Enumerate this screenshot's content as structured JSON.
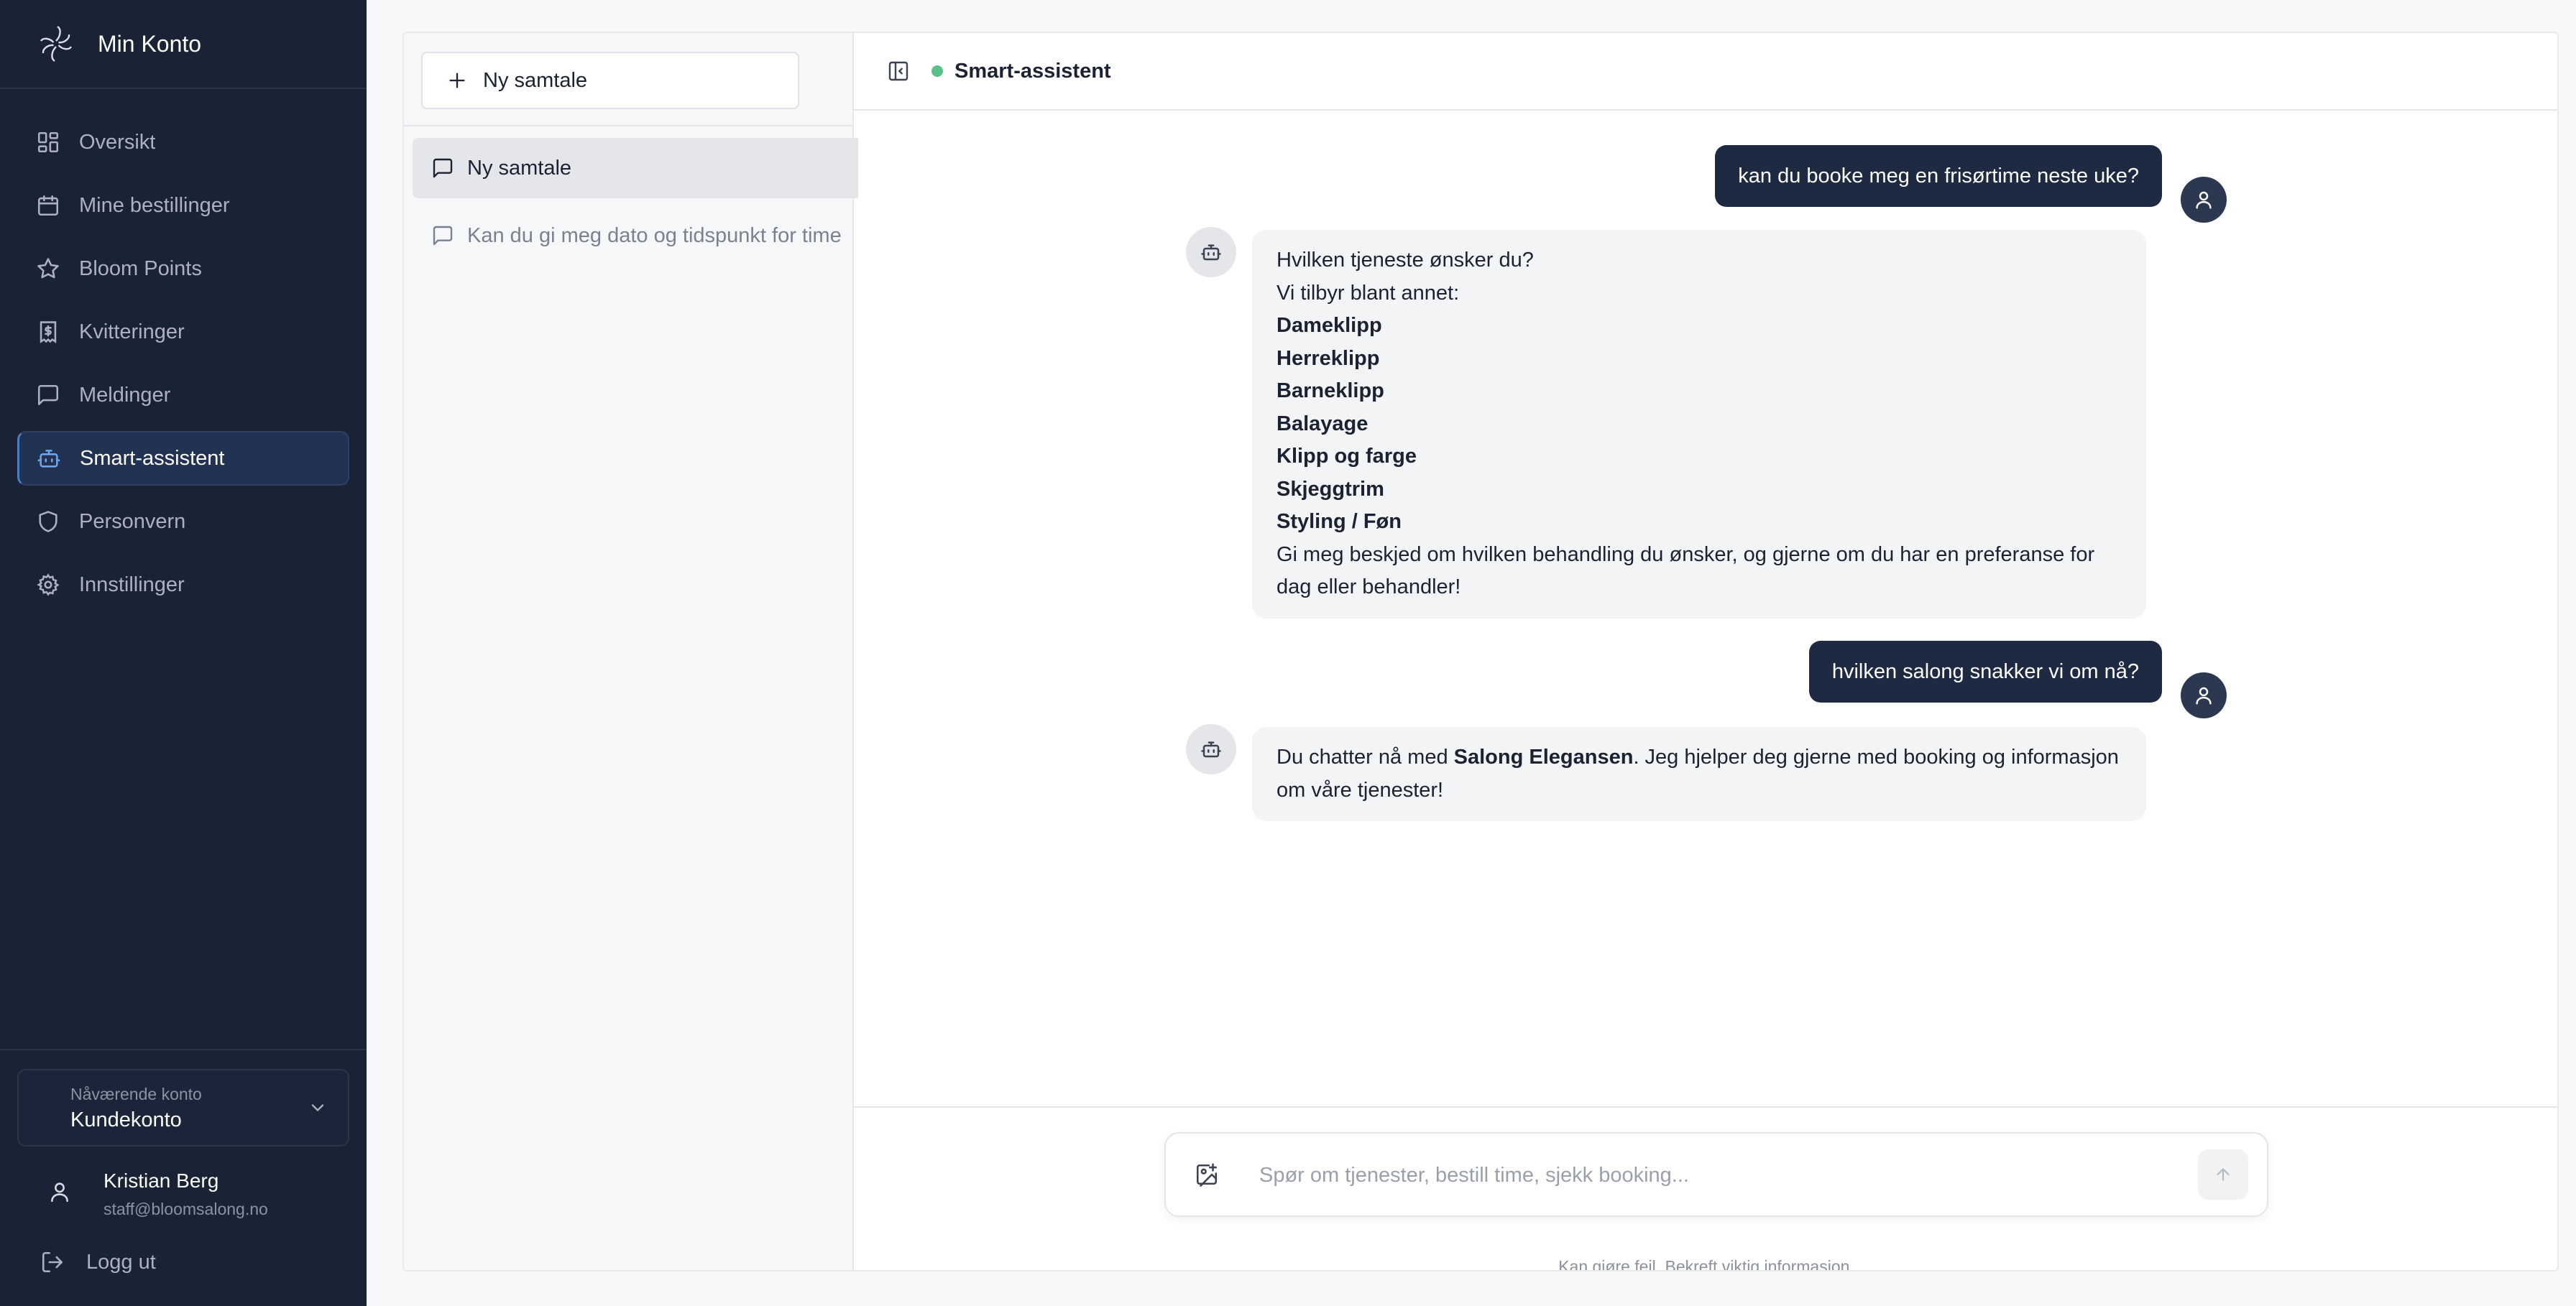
{
  "app": {
    "title": "Min Konto"
  },
  "sidebar": {
    "items": [
      {
        "label": "Oversikt",
        "icon": "grid-icon"
      },
      {
        "label": "Mine bestillinger",
        "icon": "calendar-icon"
      },
      {
        "label": "Bloom Points",
        "icon": "star-icon"
      },
      {
        "label": "Kvitteringer",
        "icon": "receipt-icon"
      },
      {
        "label": "Meldinger",
        "icon": "message-icon"
      },
      {
        "label": "Smart-assistent",
        "icon": "bot-icon",
        "active": true
      },
      {
        "label": "Personvern",
        "icon": "shield-icon"
      },
      {
        "label": "Innstillinger",
        "icon": "gear-icon"
      }
    ],
    "account": {
      "label": "Nåværende konto",
      "value": "Kundekonto"
    },
    "user": {
      "name": "Kristian Berg",
      "email": "staff@bloomsalong.no"
    },
    "logout": "Logg ut"
  },
  "conversations": {
    "new_button": "Ny samtale",
    "items": [
      {
        "title": "Ny samtale",
        "active": true
      },
      {
        "title": "Kan du gi meg dato og tidspunkt for time"
      }
    ]
  },
  "chat": {
    "title": "Smart-assistent",
    "status_color": "#5bbf8a",
    "messages": {
      "m1": "kan du booke meg en frisørtime neste uke?",
      "m2": {
        "line1": "Hvilken tjeneste ønsker du?",
        "line2": "Vi tilbyr blant annet:",
        "services": [
          "Dameklipp",
          "Herreklipp",
          "Barneklipp",
          "Balayage",
          "Klipp og farge",
          "Skjeggtrim",
          "Styling / Føn"
        ],
        "closing": "Gi meg beskjed om hvilken behandling du ønsker, og gjerne om du har en preferanse for dag eller behandler!"
      },
      "m3": "hvilken salong snakker vi om nå?",
      "m4": {
        "pre": "Du chatter nå med ",
        "bold": "Salong Elegansen",
        "post": ". Jeg hjelper deg gjerne med booking og informasjon om våre tjenester!"
      }
    },
    "composer": {
      "placeholder": "Spør om tjenester, bestill time, sjekk booking...",
      "disclaimer": "Kan gjøre feil. Bekreft viktig informasjon."
    }
  },
  "colors": {
    "sidebar_bg": "#1a2236",
    "user_bubble": "#1e2a42",
    "bot_bubble": "#f3f4f6",
    "active_accent": "#4a7fc6"
  }
}
